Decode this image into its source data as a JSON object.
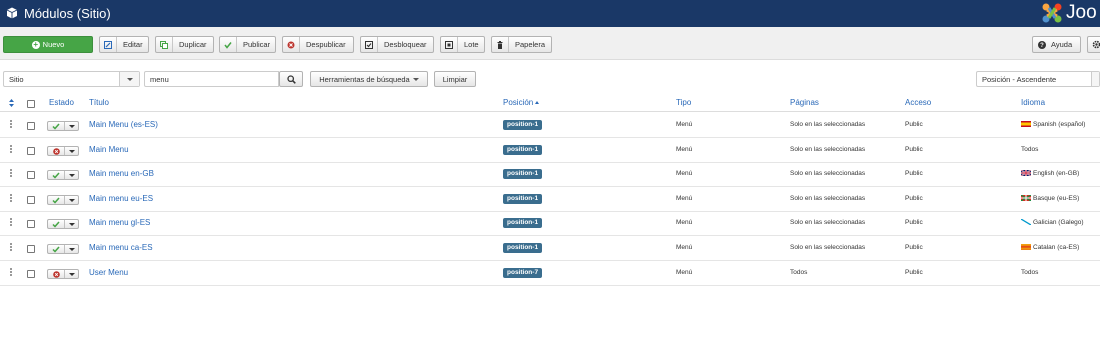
{
  "header": {
    "title": "Módulos (Sitio)",
    "logo_text": "Joo",
    "header_icon": "cube-icon",
    "logo_icon": "joomla-logo-icon"
  },
  "toolbar": {
    "new_label": "Nuevo",
    "edit_label": "Editar",
    "duplicate_label": "Duplicar",
    "publish_label": "Publicar",
    "unpublish_label": "Despublicar",
    "unlock_label": "Desbloquear",
    "batch_label": "Lote",
    "trash_label": "Papelera",
    "help_label": "Ayuda"
  },
  "filters": {
    "client": "Sitio",
    "search_value": "menu",
    "search_tools_label": "Herramientas de búsqueda",
    "clear_label": "Limpiar",
    "ordering": "Posición - Ascendente"
  },
  "table": {
    "headers": {
      "status": "Estado",
      "title": "Título",
      "position": "Posición",
      "type": "Tipo",
      "pages": "Páginas",
      "access": "Acceso",
      "language": "Idioma"
    },
    "rows": [
      {
        "published": true,
        "title": "Main Menu (es-ES)",
        "position": "position-1",
        "type": "Menú",
        "pages": "Solo en las seleccionadas",
        "access": "Public",
        "language": "Spanish (español)",
        "flag": "es"
      },
      {
        "published": false,
        "title": "Main Menu",
        "position": "position-1",
        "type": "Menú",
        "pages": "Solo en las seleccionadas",
        "access": "Public",
        "language": "Todos",
        "flag": ""
      },
      {
        "published": true,
        "title": "Main menu en-GB",
        "position": "position-1",
        "type": "Menú",
        "pages": "Solo en las seleccionadas",
        "access": "Public",
        "language": "English (en-GB)",
        "flag": "gb"
      },
      {
        "published": true,
        "title": "Main menu eu-ES",
        "position": "position-1",
        "type": "Menú",
        "pages": "Solo en las seleccionadas",
        "access": "Public",
        "language": "Basque (eu-ES)",
        "flag": "eu"
      },
      {
        "published": true,
        "title": "Main menu gl-ES",
        "position": "position-1",
        "type": "Menú",
        "pages": "Solo en las seleccionadas",
        "access": "Public",
        "language": "Galician (Galego)",
        "flag": "gl"
      },
      {
        "published": true,
        "title": "Main menu ca-ES",
        "position": "position-1",
        "type": "Menú",
        "pages": "Solo en las seleccionadas",
        "access": "Public",
        "language": "Catalan (ca-ES)",
        "flag": "ca"
      },
      {
        "published": false,
        "title": "User Menu",
        "position": "position-7",
        "type": "Menú",
        "pages": "Todos",
        "access": "Public",
        "language": "Todos",
        "flag": ""
      }
    ]
  },
  "colors": {
    "header_bg": "#1a3867",
    "new_button": "#46a546",
    "link": "#2a69b8",
    "badge": "#3a6d8e",
    "published_check": "#46a546",
    "unpublished_x": "#bd362f"
  }
}
